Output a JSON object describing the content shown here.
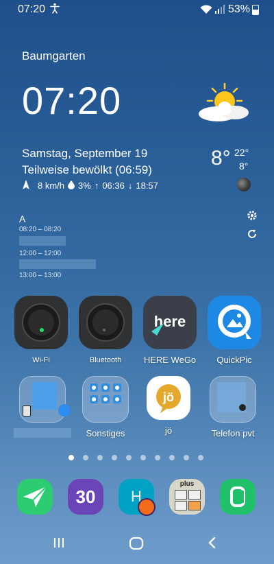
{
  "status": {
    "time": "07:20",
    "battery": "53%"
  },
  "weather": {
    "location": "Baumgarten",
    "clock": "07:20",
    "date": "Samstag, September 19",
    "condition": "Teilweise bewölkt (06:59)",
    "wind": "8 km/h",
    "precip": "3%",
    "sunrise": "06:36",
    "sunset": "18:57",
    "temp": "8°",
    "high": "22°",
    "low": "8°"
  },
  "calendar": {
    "title": "A",
    "events": [
      {
        "time": "08:20 – 08:20"
      },
      {
        "time": "12:00 – 12:00"
      },
      {
        "time": "13:00 – 13:00"
      }
    ]
  },
  "apps": {
    "row1": [
      {
        "label": "Wi-Fi",
        "icon": "wifi-widget-icon"
      },
      {
        "label": "Bluetooth",
        "icon": "bluetooth-widget-icon"
      },
      {
        "label": "HERE WeGo",
        "icon": "here-icon"
      },
      {
        "label": "QuickPic",
        "icon": "quickpic-icon"
      }
    ],
    "row2": [
      {
        "label": "",
        "icon": "folder-blurred-icon"
      },
      {
        "label": "Sonstiges",
        "icon": "folder-icon"
      },
      {
        "label": "jö",
        "icon": "jo-icon"
      },
      {
        "label": "Telefon pvt",
        "icon": "folder-icon"
      }
    ]
  },
  "dock": [
    {
      "name": "airdroid",
      "text": ""
    },
    {
      "name": "thirty",
      "text": "30"
    },
    {
      "name": "h-app",
      "text": "H"
    },
    {
      "name": "calculator",
      "text": "plus"
    },
    {
      "name": "phone",
      "text": ""
    }
  ],
  "pager": {
    "count": 10,
    "active": 0
  },
  "colors": {
    "here": "#3a3f4a",
    "quickpic": "#1e88e5",
    "jo": "#ffffff",
    "jo_accent": "#e4a82c",
    "airdroid": "#2ecc71",
    "thirty": "#6b45b8",
    "h_app": "#00a3c4",
    "phone": "#21c06b"
  }
}
